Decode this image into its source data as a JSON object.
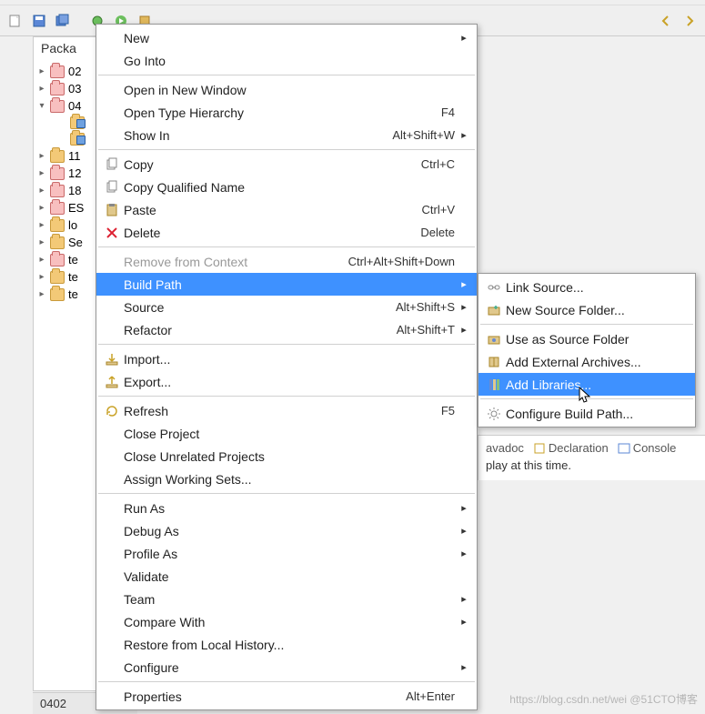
{
  "package_explorer": {
    "title": "Packa",
    "items": [
      {
        "label": "02",
        "twist": ">",
        "class": "folder-red"
      },
      {
        "label": "03",
        "twist": ">",
        "class": "folder-red"
      },
      {
        "label": "04",
        "twist": "v",
        "class": "folder-red expanded"
      },
      {
        "label": "",
        "twist": "",
        "class": "folder-blue indent"
      },
      {
        "label": "",
        "twist": "",
        "class": "folder-blue indent"
      },
      {
        "label": "11",
        "twist": ">",
        "class": ""
      },
      {
        "label": "12",
        "twist": ">",
        "class": "folder-red"
      },
      {
        "label": "18",
        "twist": ">",
        "class": "folder-red"
      },
      {
        "label": "ES",
        "twist": ">",
        "class": "folder-red"
      },
      {
        "label": "lo",
        "twist": ">",
        "class": ""
      },
      {
        "label": "Se",
        "twist": ">",
        "class": ""
      },
      {
        "label": "te",
        "twist": ">",
        "class": "folder-red"
      },
      {
        "label": "te",
        "twist": ">",
        "class": ""
      },
      {
        "label": "te",
        "twist": ">",
        "class": ""
      }
    ]
  },
  "context_menu": {
    "groups": [
      [
        {
          "label": "New",
          "accel": "",
          "arrow": true,
          "icon": ""
        },
        {
          "label": "Go Into",
          "accel": "",
          "arrow": false,
          "icon": ""
        }
      ],
      [
        {
          "label": "Open in New Window",
          "accel": "",
          "arrow": false,
          "icon": ""
        },
        {
          "label": "Open Type Hierarchy",
          "accel": "F4",
          "arrow": false,
          "icon": ""
        },
        {
          "label": "Show In",
          "accel": "Alt+Shift+W",
          "arrow": true,
          "icon": ""
        }
      ],
      [
        {
          "label": "Copy",
          "accel": "Ctrl+C",
          "arrow": false,
          "icon": "copy"
        },
        {
          "label": "Copy Qualified Name",
          "accel": "",
          "arrow": false,
          "icon": "copy"
        },
        {
          "label": "Paste",
          "accel": "Ctrl+V",
          "arrow": false,
          "icon": "paste"
        },
        {
          "label": "Delete",
          "accel": "Delete",
          "arrow": false,
          "icon": "delete"
        }
      ],
      [
        {
          "label": "Remove from Context",
          "accel": "Ctrl+Alt+Shift+Down",
          "arrow": false,
          "icon": "",
          "disabled": true
        },
        {
          "label": "Build Path",
          "accel": "",
          "arrow": true,
          "icon": "",
          "hl": true
        },
        {
          "label": "Source",
          "accel": "Alt+Shift+S",
          "arrow": true,
          "icon": ""
        },
        {
          "label": "Refactor",
          "accel": "Alt+Shift+T",
          "arrow": true,
          "icon": ""
        }
      ],
      [
        {
          "label": "Import...",
          "accel": "",
          "arrow": false,
          "icon": "import"
        },
        {
          "label": "Export...",
          "accel": "",
          "arrow": false,
          "icon": "export"
        }
      ],
      [
        {
          "label": "Refresh",
          "accel": "F5",
          "arrow": false,
          "icon": "refresh"
        },
        {
          "label": "Close Project",
          "accel": "",
          "arrow": false,
          "icon": ""
        },
        {
          "label": "Close Unrelated Projects",
          "accel": "",
          "arrow": false,
          "icon": ""
        },
        {
          "label": "Assign Working Sets...",
          "accel": "",
          "arrow": false,
          "icon": ""
        }
      ],
      [
        {
          "label": "Run As",
          "accel": "",
          "arrow": true,
          "icon": ""
        },
        {
          "label": "Debug As",
          "accel": "",
          "arrow": true,
          "icon": ""
        },
        {
          "label": "Profile As",
          "accel": "",
          "arrow": true,
          "icon": ""
        },
        {
          "label": "Validate",
          "accel": "",
          "arrow": false,
          "icon": ""
        },
        {
          "label": "Team",
          "accel": "",
          "arrow": true,
          "icon": ""
        },
        {
          "label": "Compare With",
          "accel": "",
          "arrow": true,
          "icon": ""
        },
        {
          "label": "Restore from Local History...",
          "accel": "",
          "arrow": false,
          "icon": ""
        },
        {
          "label": "Configure",
          "accel": "",
          "arrow": true,
          "icon": ""
        }
      ],
      [
        {
          "label": "Properties",
          "accel": "Alt+Enter",
          "arrow": false,
          "icon": ""
        }
      ]
    ]
  },
  "submenu": {
    "items": [
      {
        "label": "Link Source...",
        "icon": "link",
        "sep": false
      },
      {
        "label": "New Source Folder...",
        "icon": "newfolder",
        "sep": true
      },
      {
        "label": "Use as Source Folder",
        "icon": "srcfolder",
        "sep": false
      },
      {
        "label": "Add External Archives...",
        "icon": "archive",
        "sep": false
      },
      {
        "label": "Add Libraries...",
        "icon": "library",
        "hl": true,
        "sep": true
      },
      {
        "label": "Configure Build Path...",
        "icon": "config",
        "sep": false
      }
    ]
  },
  "status": "0402",
  "right_fragment": {
    "tabs": [
      "avadoc",
      "Declaration",
      "Console"
    ],
    "text": "play at this time."
  },
  "watermark": "https://blog.csdn.net/wei @51CTO博客"
}
